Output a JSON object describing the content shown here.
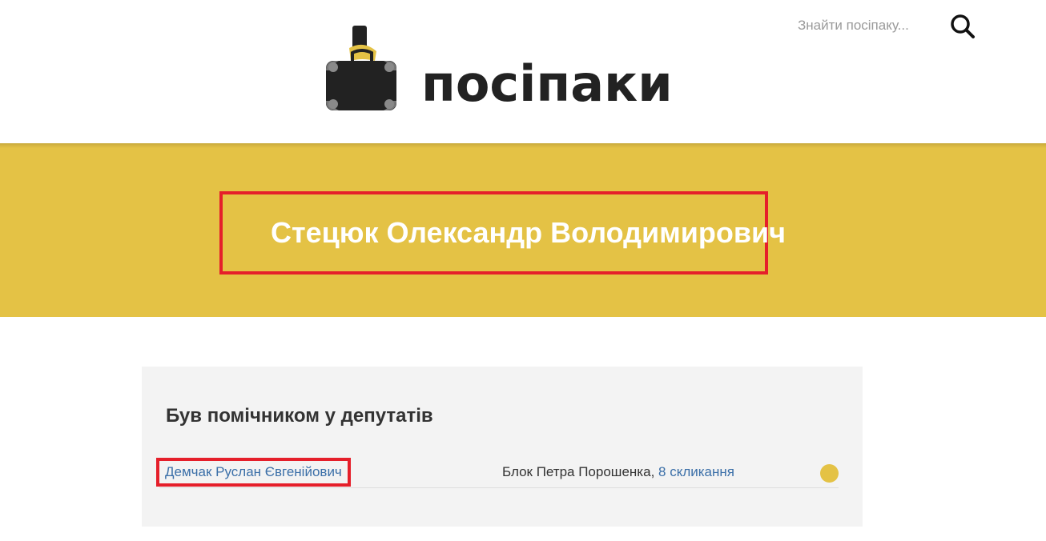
{
  "header": {
    "logo_text": "посіпаки",
    "search": {
      "placeholder": "Знайти посіпаку..."
    }
  },
  "person": {
    "name": "Стецюк Олександр Володимирович"
  },
  "assistant_section": {
    "title": "Був помічником у депутатів",
    "rows": [
      {
        "deputy_name": "Демчак Руслан Євгенійович",
        "party": "Блок Петра Порошенка",
        "separator": ", ",
        "convocation": "8 скликання"
      }
    ]
  },
  "colors": {
    "brand_yellow": "#e4c245",
    "highlight_red": "#e51f2a",
    "link_blue": "#3b6fa8",
    "logo_dark": "#222222"
  },
  "icons": {
    "logo": "briefcase-minion-logo-icon",
    "search": "search-icon",
    "party": "party-color-dot-icon"
  }
}
